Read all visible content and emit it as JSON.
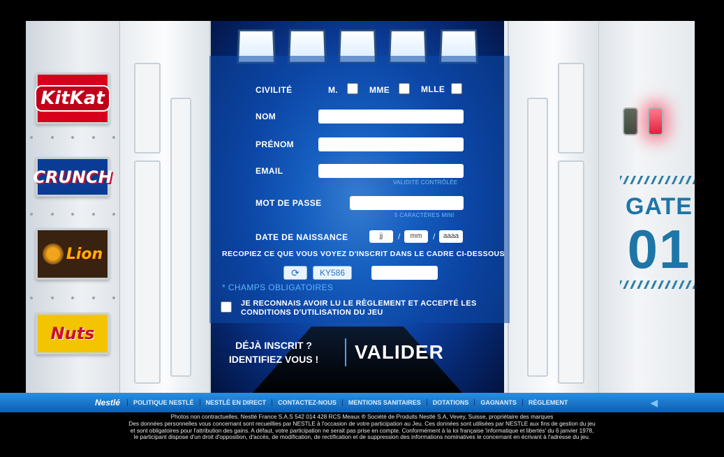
{
  "brands": [
    {
      "name": "KitKat",
      "color": "#d6001c"
    },
    {
      "name": "CRUNCH",
      "color": "#0a3c96"
    },
    {
      "name": "Lion",
      "color": "#3a2210"
    },
    {
      "name": "Nuts",
      "color": "#f3c400"
    }
  ],
  "gate": {
    "label": "GATE",
    "number": "01"
  },
  "form": {
    "civility_label": "CIVILITÉ",
    "civility_options": [
      "M.",
      "MME",
      "MLLE"
    ],
    "nom_label": "NOM",
    "prenom_label": "PRÉNOM",
    "email_label": "EMAIL",
    "email_hint": "VALIDITÉ CONTRÔLÉE",
    "password_label": "MOT DE PASSE",
    "password_hint": "5 CARACTÈRES MINI",
    "birthdate_label": "DATE DE NAISSANCE",
    "birthdate_day": "jj",
    "birthdate_month": "mm",
    "birthdate_year": "aaaa",
    "birthdate_sep": "/",
    "captcha_instruction": "RECOPIEZ CE QUE VOUS VOYEZ D'INSCRIT DANS LE CADRE CI-DESSOUS",
    "captcha_code": "KY586",
    "mandatory_note": "* CHAMPS OBLIGATOIRES",
    "rules_text_1": "JE RECONNAIS AVOIR LU LE RÈGLEMENT ET ACCEPTÉ LES",
    "rules_text_2": "CONDITIONS D'UTILISATION DU JEU"
  },
  "actions": {
    "login_line_1": "DÉJÀ INSCRIT ?",
    "login_line_2": "IDENTIFIEZ VOUS !",
    "validate": "VALIDER"
  },
  "footer": {
    "brand": "Nestlé",
    "links": [
      "POLITIQUE NESTLÉ",
      "NESTLÉ EN DIRECT",
      "CONTACTEZ-NOUS",
      "MENTIONS SANITAIRES",
      "DOTATIONS",
      "GAGNANTS",
      "RÈGLEMENT"
    ],
    "legal_1": "Photos non contractuelles. Nestlé France S.A.S 542 014 428 RCS Meaux ® Société de Produits Nestlé S.A, Vevey, Suisse, propriétaire des marques",
    "legal_2": "Des données personnelles vous concernant sont recueillies par NESTLE à l'occasion de votre participation au Jeu. Ces données sont utilisées par NESTLE aux fins de gestion du jeu",
    "legal_3": "et sont obligatoires pour l'attribution des gains. A défaut, votre participation ne serait pas prise en compte. Conformément à la loi française 'informatique et libertés' du 6 janvier 1978,",
    "legal_4": "le participant dispose  d'un droit d'opposition, d'accès, de modification, de rectification et de suppression des informations nominatives le concernant en écrivant à l'adresse du jeu."
  }
}
